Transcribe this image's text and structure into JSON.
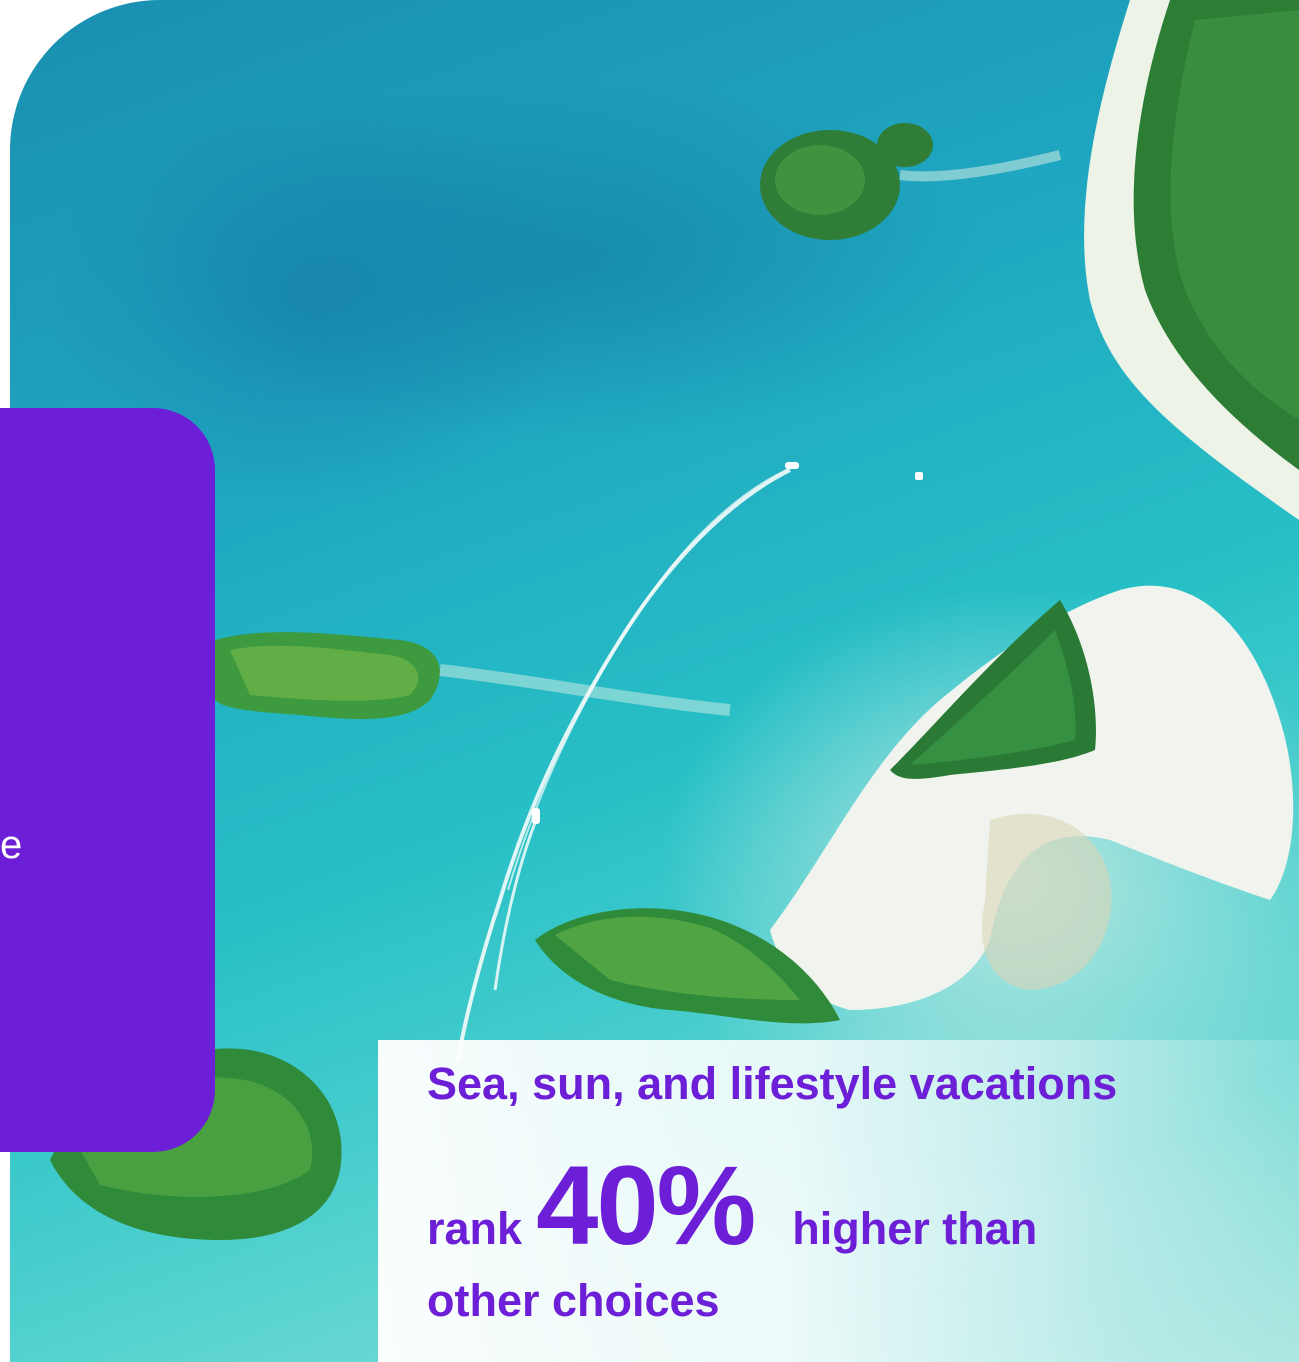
{
  "photo": {
    "subject": "aerial-tropical-islands",
    "icon": "photo-icon"
  },
  "panel": {
    "text_fragment": "e"
  },
  "caption": {
    "line1": "Sea, sun, and lifestyle vacations",
    "line2_prefix": "rank",
    "stat": "40%",
    "line2_suffix": "higher than",
    "line3": "other choices"
  },
  "colors": {
    "accent": "#6d1fd7",
    "panel_text": "#ffffff",
    "sea": "#27c0c6",
    "sand": "#e9f3ee",
    "forest": "#2f8a3a"
  }
}
